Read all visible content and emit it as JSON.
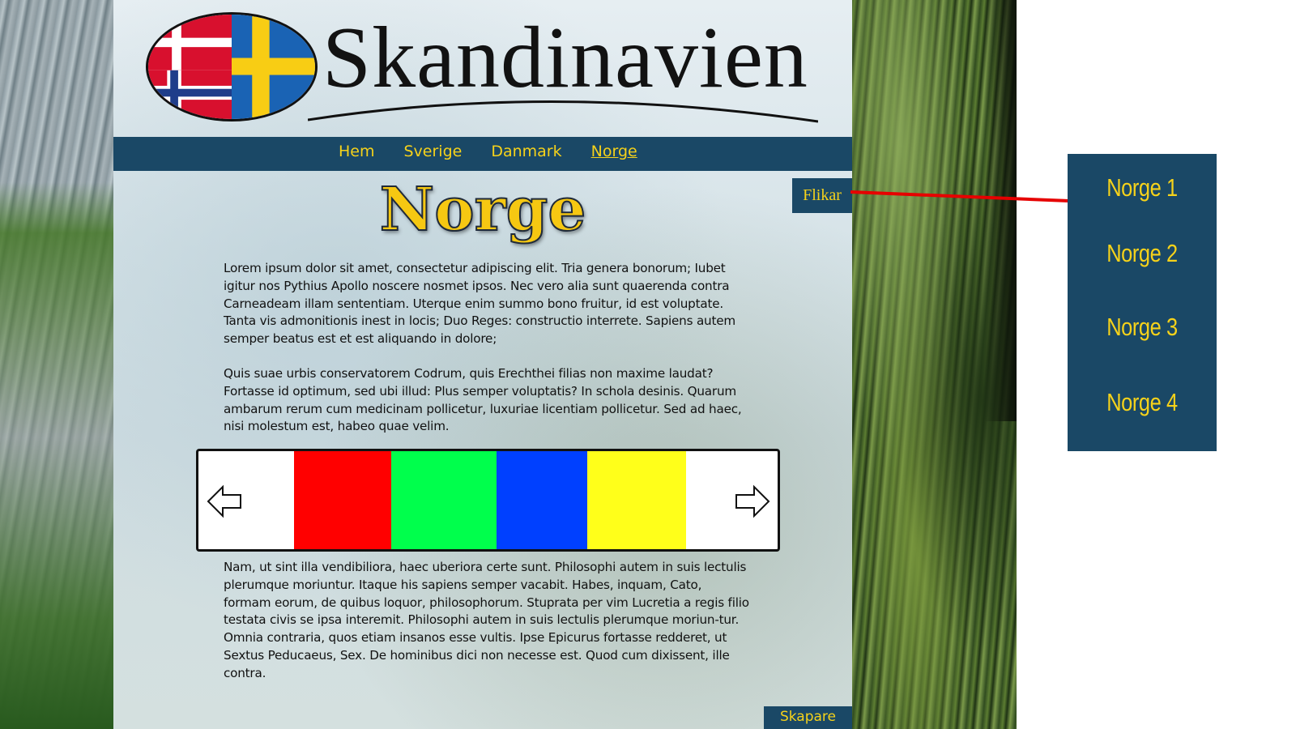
{
  "header": {
    "site_title": "Skandinavien"
  },
  "nav": {
    "items": [
      {
        "label": "Hem",
        "active": false
      },
      {
        "label": "Sverige",
        "active": false
      },
      {
        "label": "Danmark",
        "active": false
      },
      {
        "label": "Norge",
        "active": true
      }
    ]
  },
  "tab": {
    "flikar_label": "Flikar"
  },
  "main": {
    "heading": "Norge",
    "paragraphs": [
      "Lorem ipsum dolor sit amet, consectetur adipiscing elit. Tria genera bonorum; Iubet igitur nos Pythius Apollo noscere nosmet ipsos. Nec vero alia sunt quaerenda contra Carneadeam illam sententiam. Uterque enim summo bono fruitur, id est voluptate. Tanta vis admonitionis inest in locis; Duo Reges: constructio interrete. Sapiens autem semper beatus est et est aliquando in dolore;",
      "Quis suae urbis conservatorem Codrum, quis Erechthei filias non maxime laudat? Fortasse id optimum, sed ubi illud: Plus semper voluptatis? In schola desinis. Quarum ambarum rerum cum medicinam pollicetur, luxuriae licentiam pollicetur. Sed ad haec, nisi molestum est, habeo quae velim.",
      "Nam, ut sint illa vendibiliora, haec uberiora certe sunt. Philosophi autem in suis lectulis plerumque moriuntur. Itaque his sapiens semper vacabit. Habes, inquam, Cato, formam eorum, de quibus loquor, philosophorum. Stuprata per vim Lucretia a regis filio testata civis se ipsa interemit. Philosophi autem in suis lectulis plerumque moriun-tur. Omnia contraria, quos etiam insanos esse vultis. Ipse Epicurus fortasse redderet, ut Sextus Peducaeus, Sex. De hominibus dici non necesse est. Quod cum dixissent, ille contra."
    ]
  },
  "slideshow": {
    "slide_colors": [
      "#ff0000",
      "#00ff4c",
      "#0040ff",
      "#ffff1a"
    ],
    "prev_icon": "arrow-left-icon",
    "next_icon": "arrow-right-icon"
  },
  "footer": {
    "skapare_label": "Skapare"
  },
  "popup_menu": {
    "items": [
      "Norge 1",
      "Norge 2",
      "Norge 3",
      "Norge 4"
    ]
  },
  "colors": {
    "nav_background": "#1a4866",
    "accent_yellow": "#f6d21a",
    "connector_red": "#e60000"
  }
}
